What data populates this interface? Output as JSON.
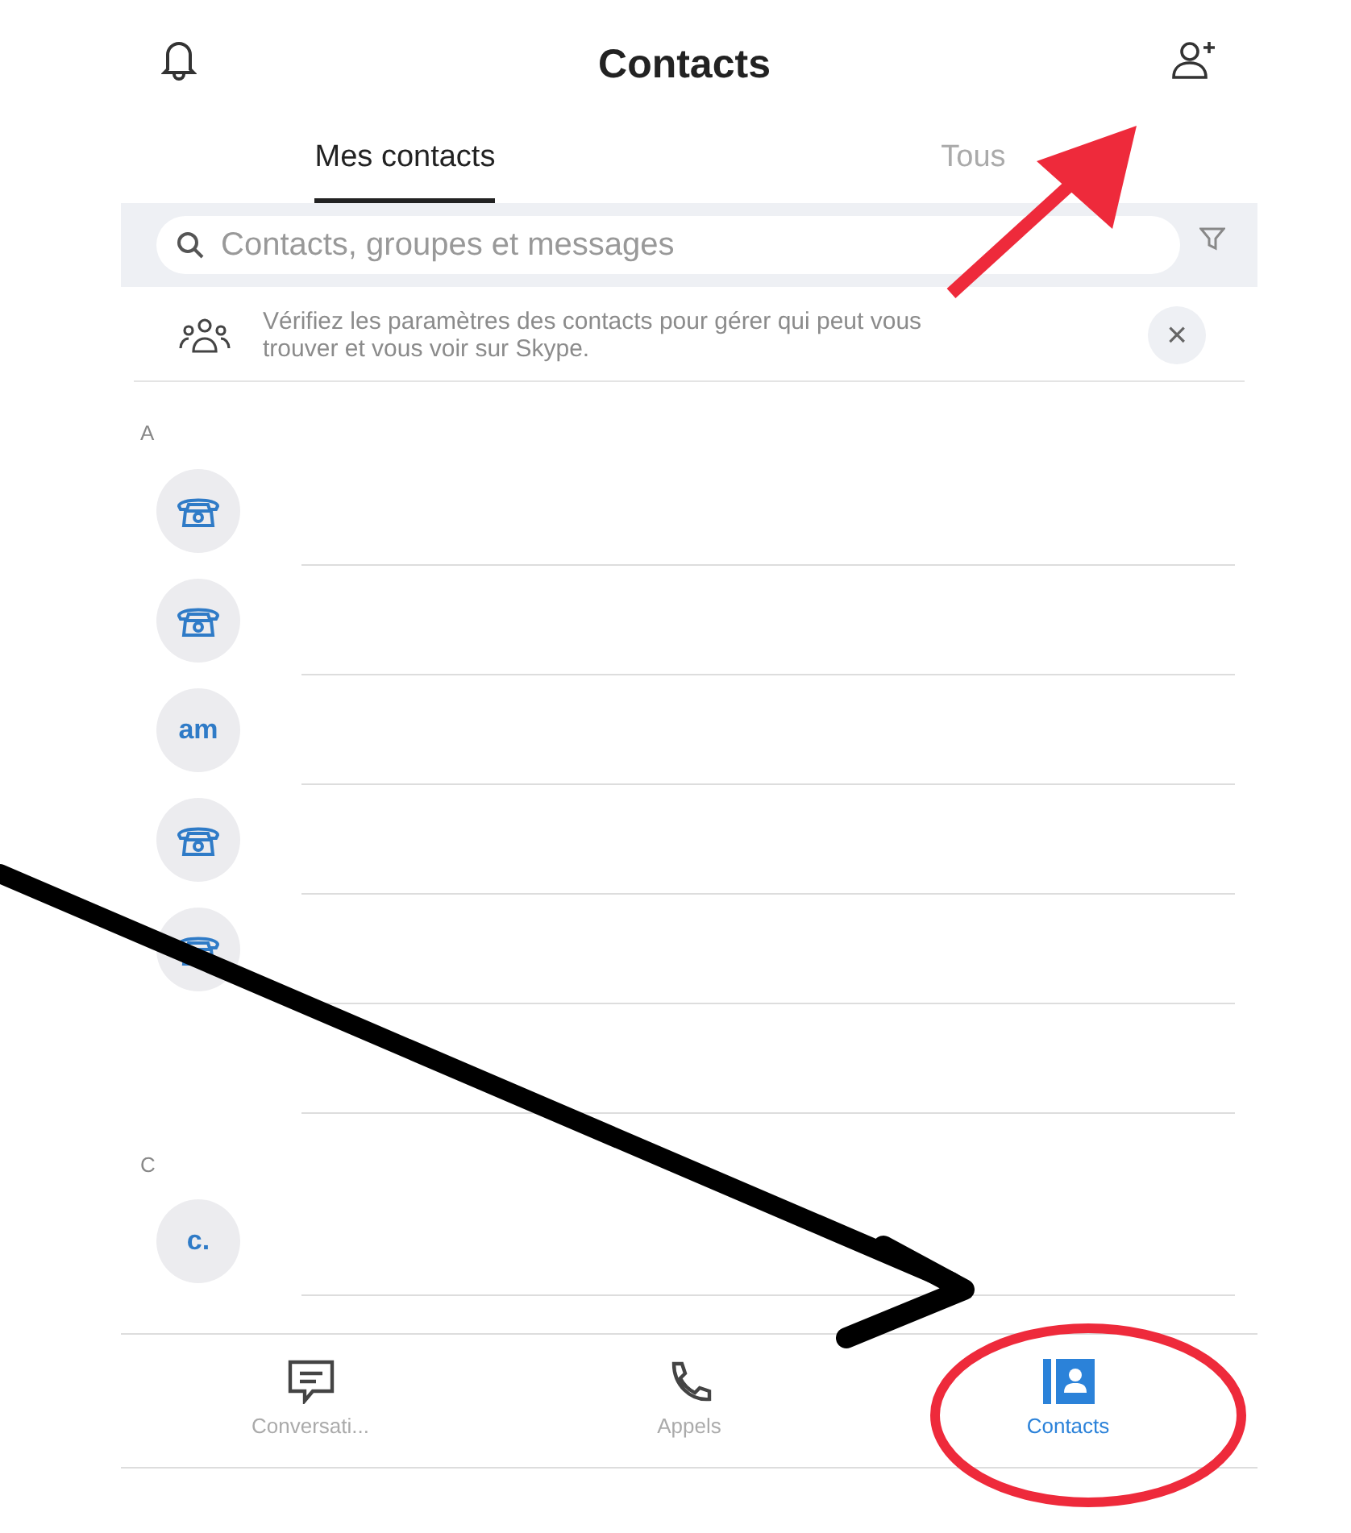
{
  "header": {
    "title": "Contacts"
  },
  "tabs": [
    {
      "label": "Mes contacts",
      "selected": true
    },
    {
      "label": "Tous",
      "selected": false
    }
  ],
  "search": {
    "placeholder": "Contacts, groupes et messages"
  },
  "banner": {
    "text": "Vérifiez les paramètres des contacts pour gérer qui peut vous trouver et vous voir sur Skype.",
    "close": "×"
  },
  "sections": [
    {
      "letter": "A",
      "contacts": [
        {
          "kind": "phone"
        },
        {
          "kind": "phone"
        },
        {
          "kind": "initials",
          "initials": "am"
        },
        {
          "kind": "phone"
        },
        {
          "kind": "phone"
        },
        {
          "kind": "blank"
        }
      ]
    },
    {
      "letter": "C",
      "contacts": [
        {
          "kind": "initials",
          "initials": "c."
        }
      ]
    }
  ],
  "nav": [
    {
      "kind": "chat",
      "label": "Conversati...",
      "selected": false
    },
    {
      "kind": "call",
      "label": "Appels",
      "selected": false
    },
    {
      "kind": "contacts",
      "label": "Contacts",
      "selected": true
    }
  ]
}
